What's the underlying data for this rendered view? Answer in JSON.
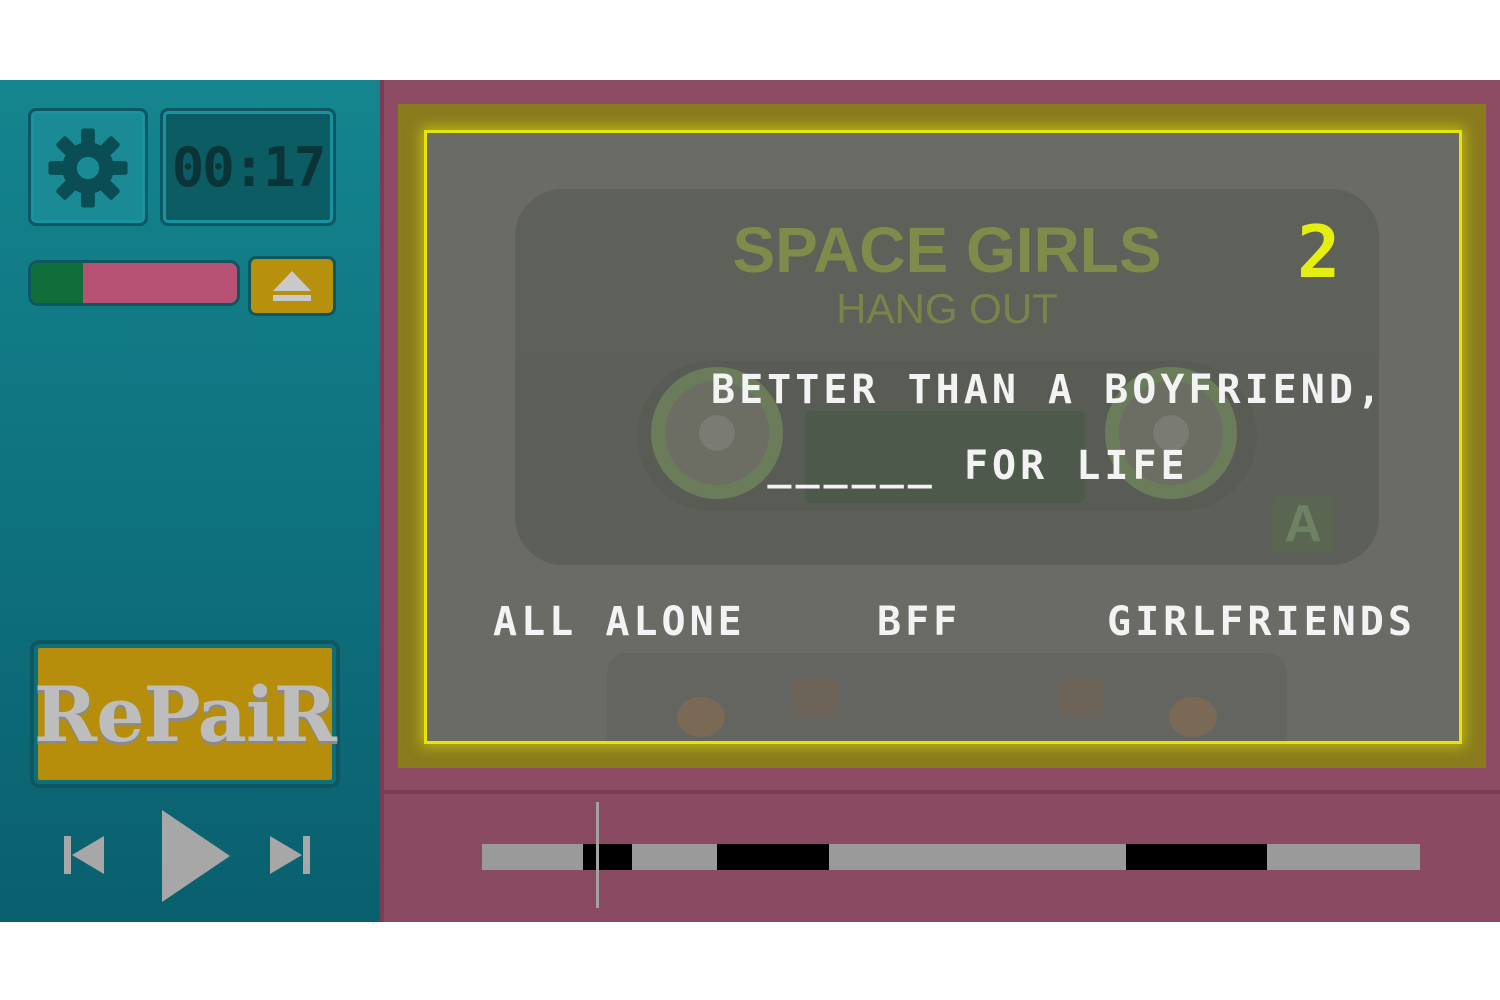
{
  "hud": {
    "timer": "00:17",
    "health_fraction": 0.25,
    "repair_label": "RePaiR"
  },
  "cassette": {
    "title": "SPACE GIRLS",
    "subtitle": "HANG OUT",
    "side": "A",
    "level_number": "2"
  },
  "question": {
    "line1": "BETTER THAN A BOYFRIEND,",
    "line2": "______ FOR LIFE"
  },
  "answers": [
    "ALL ALONE",
    "BFF",
    "GIRLFRIENDS"
  ],
  "timeline": {
    "playhead_fraction": 0.122,
    "segments": [
      {
        "start": 0.108,
        "end": 0.16
      },
      {
        "start": 0.25,
        "end": 0.37
      },
      {
        "start": 0.687,
        "end": 0.837
      }
    ]
  },
  "colors": {
    "panel_teal": "#0f7480",
    "panel_pink": "#8d4c63",
    "screen_glow": "#e6e40c",
    "accent_gold": "#b68e0b"
  },
  "icons": {
    "settings": "gear-icon",
    "eject": "eject-icon",
    "previous": "skip-previous-icon",
    "play": "play-icon",
    "next": "skip-next-icon"
  }
}
